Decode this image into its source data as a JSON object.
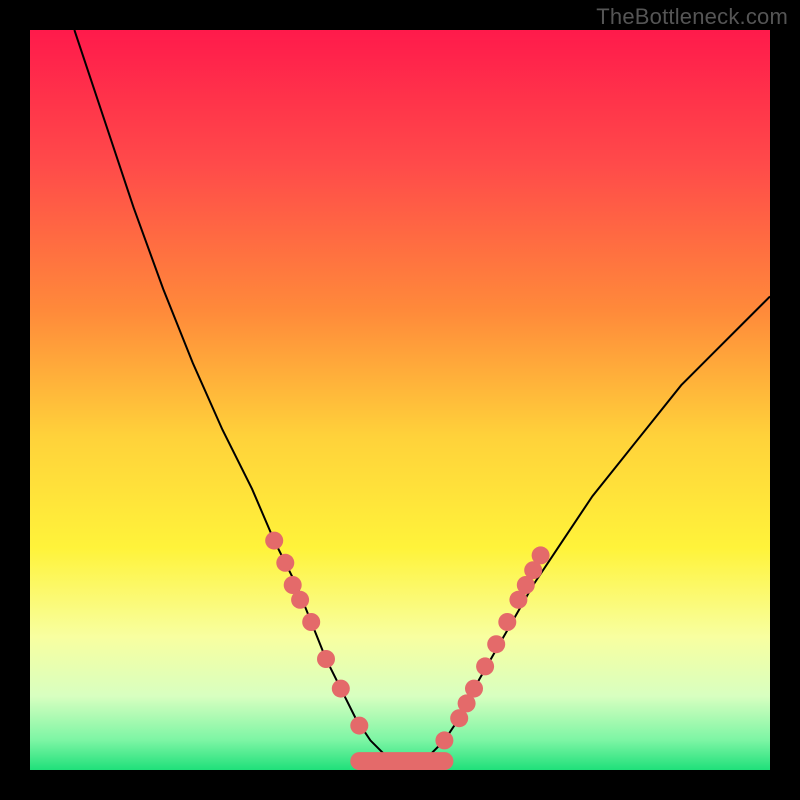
{
  "watermark": "TheBottleneck.com",
  "chart_data": {
    "type": "line",
    "title": "",
    "xlabel": "",
    "ylabel": "",
    "xlim": [
      0,
      100
    ],
    "ylim": [
      0,
      100
    ],
    "grid": false,
    "legend": false,
    "annotations": [],
    "background_gradient": {
      "stops": [
        {
          "offset": 0.0,
          "color": "#ff1a4b"
        },
        {
          "offset": 0.18,
          "color": "#ff4a4a"
        },
        {
          "offset": 0.38,
          "color": "#ff8a3a"
        },
        {
          "offset": 0.55,
          "color": "#ffd23a"
        },
        {
          "offset": 0.7,
          "color": "#fff33a"
        },
        {
          "offset": 0.82,
          "color": "#f8ffa0"
        },
        {
          "offset": 0.9,
          "color": "#d8ffc0"
        },
        {
          "offset": 0.96,
          "color": "#7cf5a4"
        },
        {
          "offset": 1.0,
          "color": "#1fe07a"
        }
      ]
    },
    "series": [
      {
        "name": "bottleneck-curve",
        "color": "#000000",
        "stroke_width": 2,
        "x": [
          6,
          10,
          14,
          18,
          22,
          26,
          30,
          33,
          36,
          38,
          40,
          42,
          44,
          46,
          48,
          50,
          52,
          54,
          56,
          58,
          60,
          64,
          68,
          72,
          76,
          80,
          84,
          88,
          92,
          96,
          100
        ],
        "y": [
          100,
          88,
          76,
          65,
          55,
          46,
          38,
          31,
          25,
          20,
          15,
          11,
          7,
          4,
          2,
          1,
          1,
          2,
          4,
          7,
          11,
          18,
          25,
          31,
          37,
          42,
          47,
          52,
          56,
          60,
          64
        ]
      }
    ],
    "markers": {
      "name": "curve-dots",
      "color": "#e46a6a",
      "radius": 9,
      "points": [
        {
          "x": 33.0,
          "y": 31
        },
        {
          "x": 34.5,
          "y": 28
        },
        {
          "x": 35.5,
          "y": 25
        },
        {
          "x": 36.5,
          "y": 23
        },
        {
          "x": 38.0,
          "y": 20
        },
        {
          "x": 40.0,
          "y": 15
        },
        {
          "x": 42.0,
          "y": 11
        },
        {
          "x": 44.5,
          "y": 6
        },
        {
          "x": 56.0,
          "y": 4
        },
        {
          "x": 58.0,
          "y": 7
        },
        {
          "x": 59.0,
          "y": 9
        },
        {
          "x": 60.0,
          "y": 11
        },
        {
          "x": 61.5,
          "y": 14
        },
        {
          "x": 63.0,
          "y": 17
        },
        {
          "x": 64.5,
          "y": 20
        },
        {
          "x": 66.0,
          "y": 23
        },
        {
          "x": 67.0,
          "y": 25
        },
        {
          "x": 68.0,
          "y": 27
        },
        {
          "x": 69.0,
          "y": 29
        }
      ]
    },
    "flat_segment": {
      "name": "bottom-bar",
      "color": "#e46a6a",
      "stroke_width": 18,
      "x1": 44.5,
      "x2": 56.0,
      "y": 1.2
    }
  }
}
